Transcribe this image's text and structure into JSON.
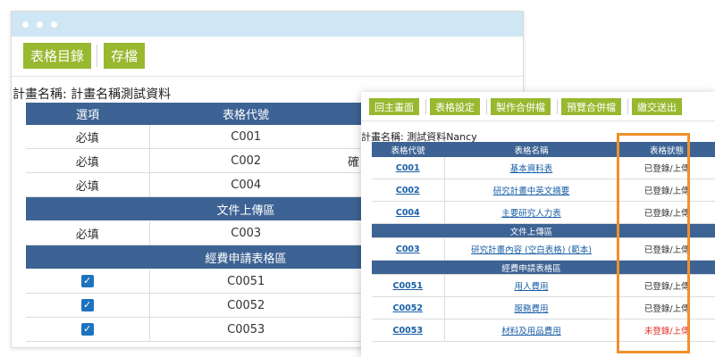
{
  "back_window": {
    "toolbar": {
      "form_list": "表格目錄",
      "save": "存檔"
    },
    "project_label": "計畫名稱: 計畫名稱測試資料",
    "headers": [
      "選項",
      "表格代號"
    ],
    "rows": [
      {
        "type": "row",
        "option": "必填",
        "code": "C001"
      },
      {
        "type": "row",
        "option": "必填",
        "code": "C002"
      },
      {
        "type": "row",
        "option": "必填",
        "code": "C004"
      },
      {
        "type": "section",
        "title": "文件上傳區"
      },
      {
        "type": "row",
        "option": "必填",
        "code": "C003"
      },
      {
        "type": "section",
        "title": "經費申請表格區"
      },
      {
        "type": "check",
        "checked": true,
        "code": "C0051"
      },
      {
        "type": "check",
        "checked": true,
        "code": "C0052"
      },
      {
        "type": "check",
        "checked": true,
        "code": "C0053"
      }
    ],
    "partial_char": "確"
  },
  "front_window": {
    "toolbar": {
      "home": "回主畫面",
      "form_settings": "表格設定",
      "make_merged": "製作合併檔",
      "preview_merged": "預覽合併檔",
      "submit": "繳交送出"
    },
    "project_label": "計畫名稱: 測試資料Nancy",
    "headers": [
      "表格代號",
      "表格名稱",
      "表格狀態"
    ],
    "rows": [
      {
        "type": "row",
        "code": "C001",
        "name": "基本資料表",
        "status": "已登錄/上傳"
      },
      {
        "type": "row",
        "code": "C002",
        "name": "研究計畫中英文摘要",
        "status": "已登錄/上傳"
      },
      {
        "type": "row",
        "code": "C004",
        "name": "主要研究人力表",
        "status": "已登錄/上傳"
      },
      {
        "type": "section",
        "title": "文件上傳區"
      },
      {
        "type": "row",
        "code": "C003",
        "name": "研究計畫內容 (空白表格) (範本)",
        "status": "已登錄/上傳"
      },
      {
        "type": "section",
        "title": "經費申請表格區"
      },
      {
        "type": "row",
        "code": "C0051",
        "name": "用人費用",
        "status": "已登錄/上傳"
      },
      {
        "type": "row",
        "code": "C0052",
        "name": "服務費用",
        "status": "已登錄/上傳"
      },
      {
        "type": "row",
        "code": "C0053",
        "name": "材料及用品費用",
        "status": "未登錄/上傳",
        "status_color": "#e0302a"
      }
    ]
  },
  "colors": {
    "accent_green": "#98b82f",
    "header_blue": "#3d6394",
    "link_blue": "#1a5fa6",
    "highlight_orange": "#f0902a",
    "titlebar": "#cfe6f4"
  }
}
